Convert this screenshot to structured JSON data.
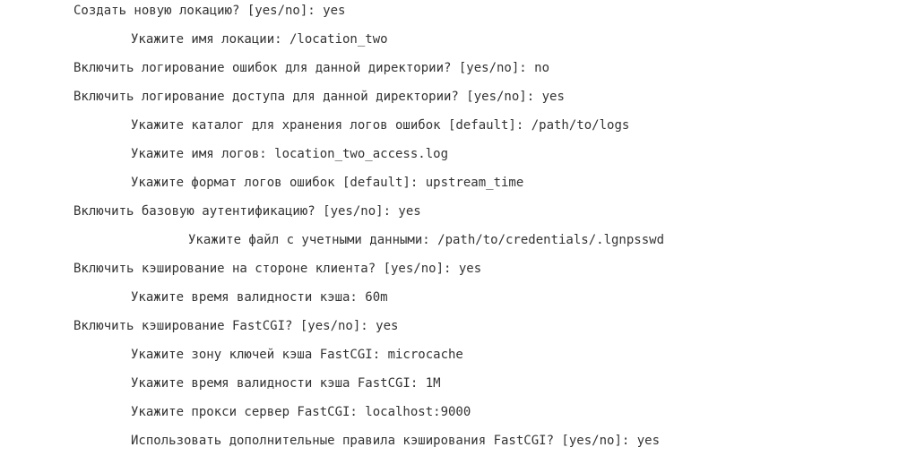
{
  "terminal": {
    "lines": [
      "Создать новую локацию? [yes/no]: yes",
      "Укажите имя локации: /location_two",
      "Включить логирование ошибок для данной директории? [yes/no]: no",
      "Включить логирование доступа для данной директории? [yes/no]: yes",
      "Укажите каталог для хранения логов ошибок [default]: /path/to/logs",
      "Укажите имя логов: location_two_access.log",
      "Укажите формат логов ошибок [default]: upstream_time",
      "Включить базовую аутентификацию? [yes/no]: yes",
      "Укажите файл с учетными данными: /path/to/credentials/.lgnpsswd",
      "Включить кэширование на стороне клиента? [yes/no]: yes",
      "Укажите время валидности кэша: 60m",
      "Включить кэширование FastCGI? [yes/no]: yes",
      "Укажите зону ключей кэша FastCGI: microcache",
      "Укажите время валидности кэша FastCGI: 1M",
      "Укажите прокси сервер FastCGI: localhost:9000",
      "Использовать дополнительные правила кэширования FastCGI? [yes/no]: yes"
    ]
  }
}
